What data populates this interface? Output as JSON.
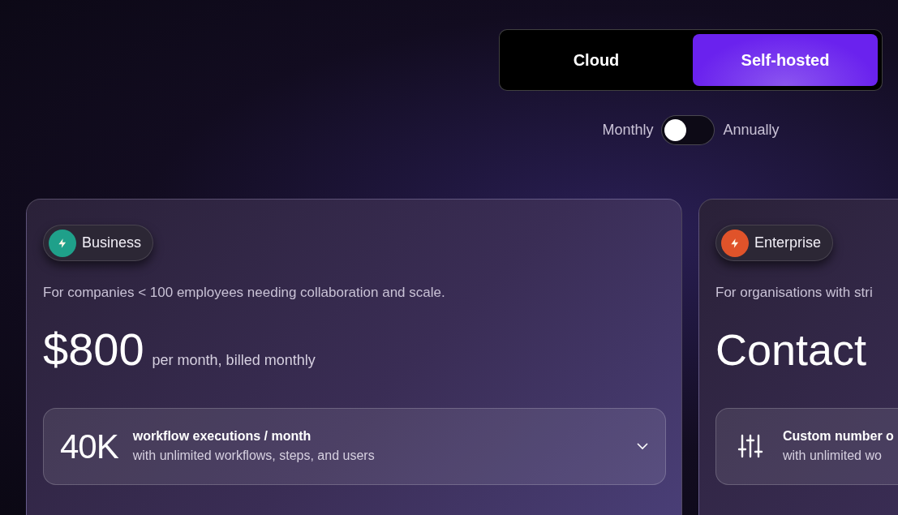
{
  "deployment_tabs": [
    {
      "label": "Cloud",
      "selected": false
    },
    {
      "label": "Self-hosted",
      "selected": true
    }
  ],
  "billing": {
    "left_label": "Monthly",
    "right_label": "Annually",
    "on": false
  },
  "plans": [
    {
      "name": "Business",
      "color": "#1fa08a",
      "description": "For companies < 100 employees needing collaboration and scale.",
      "price": "$800",
      "price_note": "per month, billed monthly",
      "feature": {
        "kind": "amount",
        "amount": "40K",
        "title": "workflow executions / month",
        "subtitle": "with unlimited workflows, steps, and users"
      }
    },
    {
      "name": "Enterprise",
      "color": "#e0532a",
      "description": "For organisations with stri",
      "price": "Contact",
      "feature": {
        "kind": "custom",
        "title": "Custom number o",
        "subtitle": "with unlimited wo"
      }
    }
  ]
}
